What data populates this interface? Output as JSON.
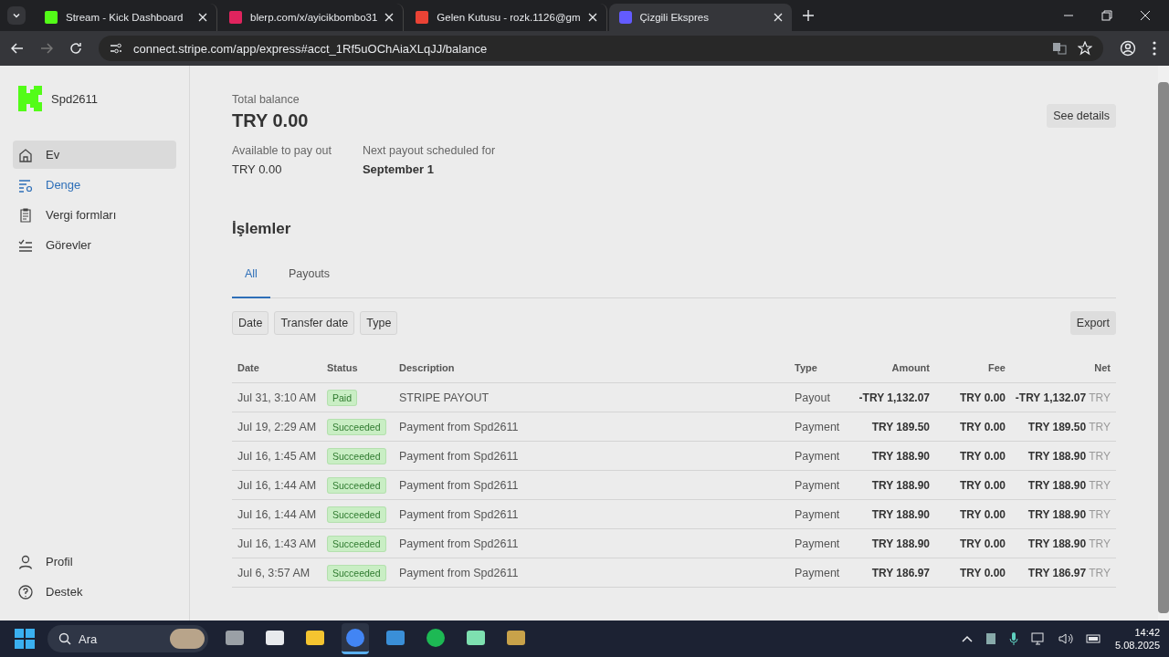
{
  "browser": {
    "tabs": [
      {
        "title": "Stream - Kick Dashboard",
        "kind": "kick",
        "selected": false
      },
      {
        "title": "blerp.com/x/ayicikbombo31",
        "kind": "blerp",
        "selected": false
      },
      {
        "title": "Gelen Kutusu - rozk.1126@gm",
        "kind": "mail",
        "selected": false
      },
      {
        "title": "Çizgili Ekspres",
        "kind": "stripe",
        "selected": true
      }
    ],
    "address": "connect.stripe.com/app/express#acct_1Rf5uOChAiaXLqJJ/balance"
  },
  "sidebar": {
    "account": "Spd2611",
    "items": [
      {
        "label": "Ev",
        "kind": "home",
        "selected": false,
        "hovered": true
      },
      {
        "label": "Denge",
        "kind": "balance",
        "selected": true,
        "hovered": false
      },
      {
        "label": "Vergi formları",
        "kind": "tax",
        "selected": false,
        "hovered": false
      },
      {
        "label": "Görevler",
        "kind": "tasks",
        "selected": false,
        "hovered": false
      }
    ],
    "footer": [
      {
        "label": "Profil",
        "kind": "person"
      },
      {
        "label": "Destek",
        "kind": "help"
      }
    ]
  },
  "balance": {
    "label": "Total balance",
    "value": "TRY 0.00",
    "available_label": "Available to pay out",
    "available": "TRY 0.00",
    "next_label": "Next payout scheduled for",
    "next": "September 1",
    "details_button": "See details"
  },
  "transactions": {
    "title": "İşlemler",
    "tabs": [
      {
        "label": "All",
        "selected": true
      },
      {
        "label": "Payouts",
        "selected": false
      }
    ],
    "filters": [
      "Date",
      "Transfer date",
      "Type"
    ],
    "export": "Export",
    "columns": [
      "Date",
      "Status",
      "Description",
      "Type",
      "Amount",
      "Fee",
      "Net"
    ],
    "rows": [
      {
        "date": "Jul 31, 3:10 AM",
        "status": "Paid",
        "description": "STRIPE PAYOUT",
        "type": "Payout",
        "amount": "-TRY 1,132.07",
        "fee": "TRY 0.00",
        "net": "-TRY 1,132.07",
        "currency": "TRY"
      },
      {
        "date": "Jul 19, 2:29 AM",
        "status": "Succeeded",
        "description": "Payment from Spd2611",
        "type": "Payment",
        "amount": "TRY 189.50",
        "fee": "TRY 0.00",
        "net": "TRY 189.50",
        "currency": "TRY"
      },
      {
        "date": "Jul 16, 1:45 AM",
        "status": "Succeeded",
        "description": "Payment from Spd2611",
        "type": "Payment",
        "amount": "TRY 188.90",
        "fee": "TRY 0.00",
        "net": "TRY 188.90",
        "currency": "TRY"
      },
      {
        "date": "Jul 16, 1:44 AM",
        "status": "Succeeded",
        "description": "Payment from Spd2611",
        "type": "Payment",
        "amount": "TRY 188.90",
        "fee": "TRY 0.00",
        "net": "TRY 188.90",
        "currency": "TRY"
      },
      {
        "date": "Jul 16, 1:44 AM",
        "status": "Succeeded",
        "description": "Payment from Spd2611",
        "type": "Payment",
        "amount": "TRY 188.90",
        "fee": "TRY 0.00",
        "net": "TRY 188.90",
        "currency": "TRY"
      },
      {
        "date": "Jul 16, 1:43 AM",
        "status": "Succeeded",
        "description": "Payment from Spd2611",
        "type": "Payment",
        "amount": "TRY 188.90",
        "fee": "TRY 0.00",
        "net": "TRY 188.90",
        "currency": "TRY"
      },
      {
        "date": "Jul 6, 3:57 AM",
        "status": "Succeeded",
        "description": "Payment from Spd2611",
        "type": "Payment",
        "amount": "TRY 186.97",
        "fee": "TRY 0.00",
        "net": "TRY 186.97",
        "currency": "TRY"
      }
    ]
  },
  "taskbar": {
    "search_placeholder": "Ara",
    "apps": [
      {
        "kind": "taskview",
        "active": false
      },
      {
        "kind": "store",
        "active": false
      },
      {
        "kind": "folder",
        "active": false
      },
      {
        "kind": "chrome",
        "active": true
      },
      {
        "kind": "chart",
        "active": false
      },
      {
        "kind": "music",
        "active": false
      },
      {
        "kind": "chat",
        "active": false
      },
      {
        "kind": "game",
        "active": false
      }
    ],
    "time": "14:42",
    "date": "5.08.2025"
  }
}
